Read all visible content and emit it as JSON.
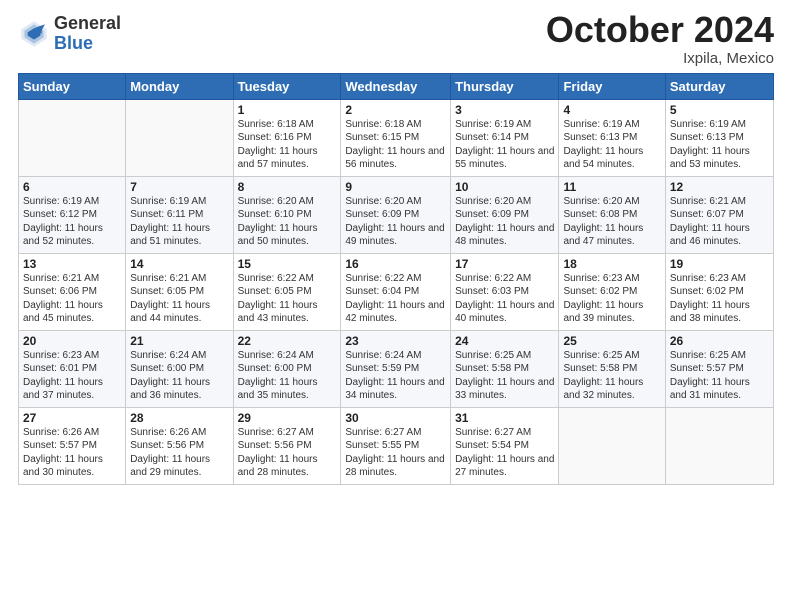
{
  "logo": {
    "general": "General",
    "blue": "Blue"
  },
  "title": "October 2024",
  "location": "Ixpila, Mexico",
  "days_header": [
    "Sunday",
    "Monday",
    "Tuesday",
    "Wednesday",
    "Thursday",
    "Friday",
    "Saturday"
  ],
  "weeks": [
    [
      {
        "day": "",
        "info": ""
      },
      {
        "day": "",
        "info": ""
      },
      {
        "day": "1",
        "info": "Sunrise: 6:18 AM\nSunset: 6:16 PM\nDaylight: 11 hours\nand 57 minutes."
      },
      {
        "day": "2",
        "info": "Sunrise: 6:18 AM\nSunset: 6:15 PM\nDaylight: 11 hours\nand 56 minutes."
      },
      {
        "day": "3",
        "info": "Sunrise: 6:19 AM\nSunset: 6:14 PM\nDaylight: 11 hours\nand 55 minutes."
      },
      {
        "day": "4",
        "info": "Sunrise: 6:19 AM\nSunset: 6:13 PM\nDaylight: 11 hours\nand 54 minutes."
      },
      {
        "day": "5",
        "info": "Sunrise: 6:19 AM\nSunset: 6:13 PM\nDaylight: 11 hours\nand 53 minutes."
      }
    ],
    [
      {
        "day": "6",
        "info": "Sunrise: 6:19 AM\nSunset: 6:12 PM\nDaylight: 11 hours\nand 52 minutes."
      },
      {
        "day": "7",
        "info": "Sunrise: 6:19 AM\nSunset: 6:11 PM\nDaylight: 11 hours\nand 51 minutes."
      },
      {
        "day": "8",
        "info": "Sunrise: 6:20 AM\nSunset: 6:10 PM\nDaylight: 11 hours\nand 50 minutes."
      },
      {
        "day": "9",
        "info": "Sunrise: 6:20 AM\nSunset: 6:09 PM\nDaylight: 11 hours\nand 49 minutes."
      },
      {
        "day": "10",
        "info": "Sunrise: 6:20 AM\nSunset: 6:09 PM\nDaylight: 11 hours\nand 48 minutes."
      },
      {
        "day": "11",
        "info": "Sunrise: 6:20 AM\nSunset: 6:08 PM\nDaylight: 11 hours\nand 47 minutes."
      },
      {
        "day": "12",
        "info": "Sunrise: 6:21 AM\nSunset: 6:07 PM\nDaylight: 11 hours\nand 46 minutes."
      }
    ],
    [
      {
        "day": "13",
        "info": "Sunrise: 6:21 AM\nSunset: 6:06 PM\nDaylight: 11 hours\nand 45 minutes."
      },
      {
        "day": "14",
        "info": "Sunrise: 6:21 AM\nSunset: 6:05 PM\nDaylight: 11 hours\nand 44 minutes."
      },
      {
        "day": "15",
        "info": "Sunrise: 6:22 AM\nSunset: 6:05 PM\nDaylight: 11 hours\nand 43 minutes."
      },
      {
        "day": "16",
        "info": "Sunrise: 6:22 AM\nSunset: 6:04 PM\nDaylight: 11 hours\nand 42 minutes."
      },
      {
        "day": "17",
        "info": "Sunrise: 6:22 AM\nSunset: 6:03 PM\nDaylight: 11 hours\nand 40 minutes."
      },
      {
        "day": "18",
        "info": "Sunrise: 6:23 AM\nSunset: 6:02 PM\nDaylight: 11 hours\nand 39 minutes."
      },
      {
        "day": "19",
        "info": "Sunrise: 6:23 AM\nSunset: 6:02 PM\nDaylight: 11 hours\nand 38 minutes."
      }
    ],
    [
      {
        "day": "20",
        "info": "Sunrise: 6:23 AM\nSunset: 6:01 PM\nDaylight: 11 hours\nand 37 minutes."
      },
      {
        "day": "21",
        "info": "Sunrise: 6:24 AM\nSunset: 6:00 PM\nDaylight: 11 hours\nand 36 minutes."
      },
      {
        "day": "22",
        "info": "Sunrise: 6:24 AM\nSunset: 6:00 PM\nDaylight: 11 hours\nand 35 minutes."
      },
      {
        "day": "23",
        "info": "Sunrise: 6:24 AM\nSunset: 5:59 PM\nDaylight: 11 hours\nand 34 minutes."
      },
      {
        "day": "24",
        "info": "Sunrise: 6:25 AM\nSunset: 5:58 PM\nDaylight: 11 hours\nand 33 minutes."
      },
      {
        "day": "25",
        "info": "Sunrise: 6:25 AM\nSunset: 5:58 PM\nDaylight: 11 hours\nand 32 minutes."
      },
      {
        "day": "26",
        "info": "Sunrise: 6:25 AM\nSunset: 5:57 PM\nDaylight: 11 hours\nand 31 minutes."
      }
    ],
    [
      {
        "day": "27",
        "info": "Sunrise: 6:26 AM\nSunset: 5:57 PM\nDaylight: 11 hours\nand 30 minutes."
      },
      {
        "day": "28",
        "info": "Sunrise: 6:26 AM\nSunset: 5:56 PM\nDaylight: 11 hours\nand 29 minutes."
      },
      {
        "day": "29",
        "info": "Sunrise: 6:27 AM\nSunset: 5:56 PM\nDaylight: 11 hours\nand 28 minutes."
      },
      {
        "day": "30",
        "info": "Sunrise: 6:27 AM\nSunset: 5:55 PM\nDaylight: 11 hours\nand 28 minutes."
      },
      {
        "day": "31",
        "info": "Sunrise: 6:27 AM\nSunset: 5:54 PM\nDaylight: 11 hours\nand 27 minutes."
      },
      {
        "day": "",
        "info": ""
      },
      {
        "day": "",
        "info": ""
      }
    ]
  ]
}
